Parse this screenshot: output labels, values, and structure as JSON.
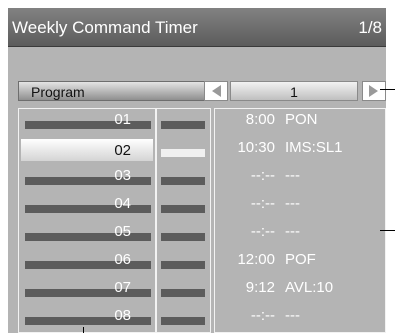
{
  "header": {
    "title": "Weekly Command Timer",
    "page": "1/8"
  },
  "program": {
    "label": "Program",
    "value": "1"
  },
  "rows": [
    {
      "num": "01",
      "time": "8:00",
      "cmd": "PON",
      "selected": false
    },
    {
      "num": "02",
      "time": "10:30",
      "cmd": "IMS:SL1",
      "selected": true
    },
    {
      "num": "03",
      "time": "--:--",
      "cmd": "---",
      "selected": false
    },
    {
      "num": "04",
      "time": "--:--",
      "cmd": "---",
      "selected": false
    },
    {
      "num": "05",
      "time": "--:--",
      "cmd": "---",
      "selected": false
    },
    {
      "num": "06",
      "time": "12:00",
      "cmd": "POF",
      "selected": false
    },
    {
      "num": "07",
      "time": "9:12",
      "cmd": "AVL:10",
      "selected": false
    },
    {
      "num": "08",
      "time": "--:--",
      "cmd": "---",
      "selected": false
    }
  ],
  "icons": {
    "prev": "arrow-left-icon",
    "next": "arrow-right-icon"
  },
  "colors": {
    "header": "#6a6a6a",
    "panel": "#b4b4b4",
    "selected": "#f0f0f0"
  }
}
